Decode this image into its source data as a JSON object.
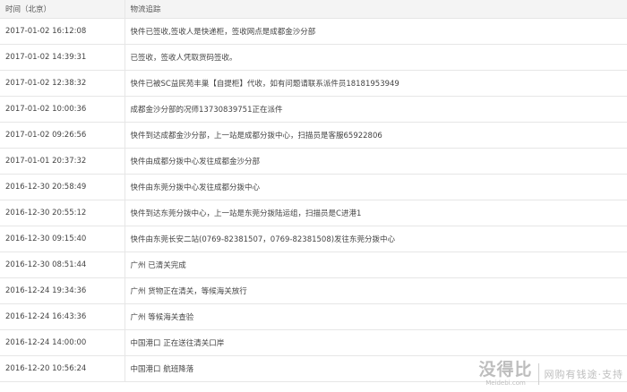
{
  "table": {
    "headers": [
      "时间（北京）",
      "物流追踪"
    ],
    "rows": [
      {
        "time": "2017-01-02 16:12:08",
        "status": "快件已签收,签收人是快递柜，签收网点是成都金沙分部"
      },
      {
        "time": "2017-01-02 14:39:31",
        "status": "已签收，签收人凭取货码签收。"
      },
      {
        "time": "2017-01-02 12:38:32",
        "status": "快件已被SC益民苑丰巢【自提柜】代收，如有问题请联系派件员18181953949"
      },
      {
        "time": "2017-01-02 10:00:36",
        "status": "成都金沙分部的况师13730839751正在派件"
      },
      {
        "time": "2017-01-02 09:26:56",
        "status": "快件到达成都金沙分部，上一站是成都分拨中心，扫描员是客服65922806"
      },
      {
        "time": "2017-01-01 20:37:32",
        "status": "快件由成都分拨中心发往成都金沙分部"
      },
      {
        "time": "2016-12-30 20:58:49",
        "status": "快件由东莞分拨中心发往成都分拨中心"
      },
      {
        "time": "2016-12-30 20:55:12",
        "status": "快件到达东莞分拨中心，上一站是东莞分拨陆运组，扫描员是C进港1"
      },
      {
        "time": "2016-12-30 09:15:40",
        "status": "快件由东莞长安二站(0769-82381507，0769-82381508)发往东莞分拨中心"
      },
      {
        "time": "2016-12-30 08:51:44",
        "status": "广州 已清关完成"
      },
      {
        "time": "2016-12-24 19:34:36",
        "status": "广州 货物正在清关，等候海关放行"
      },
      {
        "time": "2016-12-24 16:43:36",
        "status": "广州 等候海关查验"
      },
      {
        "time": "2016-12-24 14:00:00",
        "status": "中国港口 正在送往清关口岸"
      },
      {
        "time": "2016-12-20 10:56:24",
        "status": "中国港口 航班降落"
      }
    ]
  },
  "watermark": {
    "name": "没得比",
    "domain": "Meidebi.com",
    "slogan": "网购有钱途·支持"
  }
}
